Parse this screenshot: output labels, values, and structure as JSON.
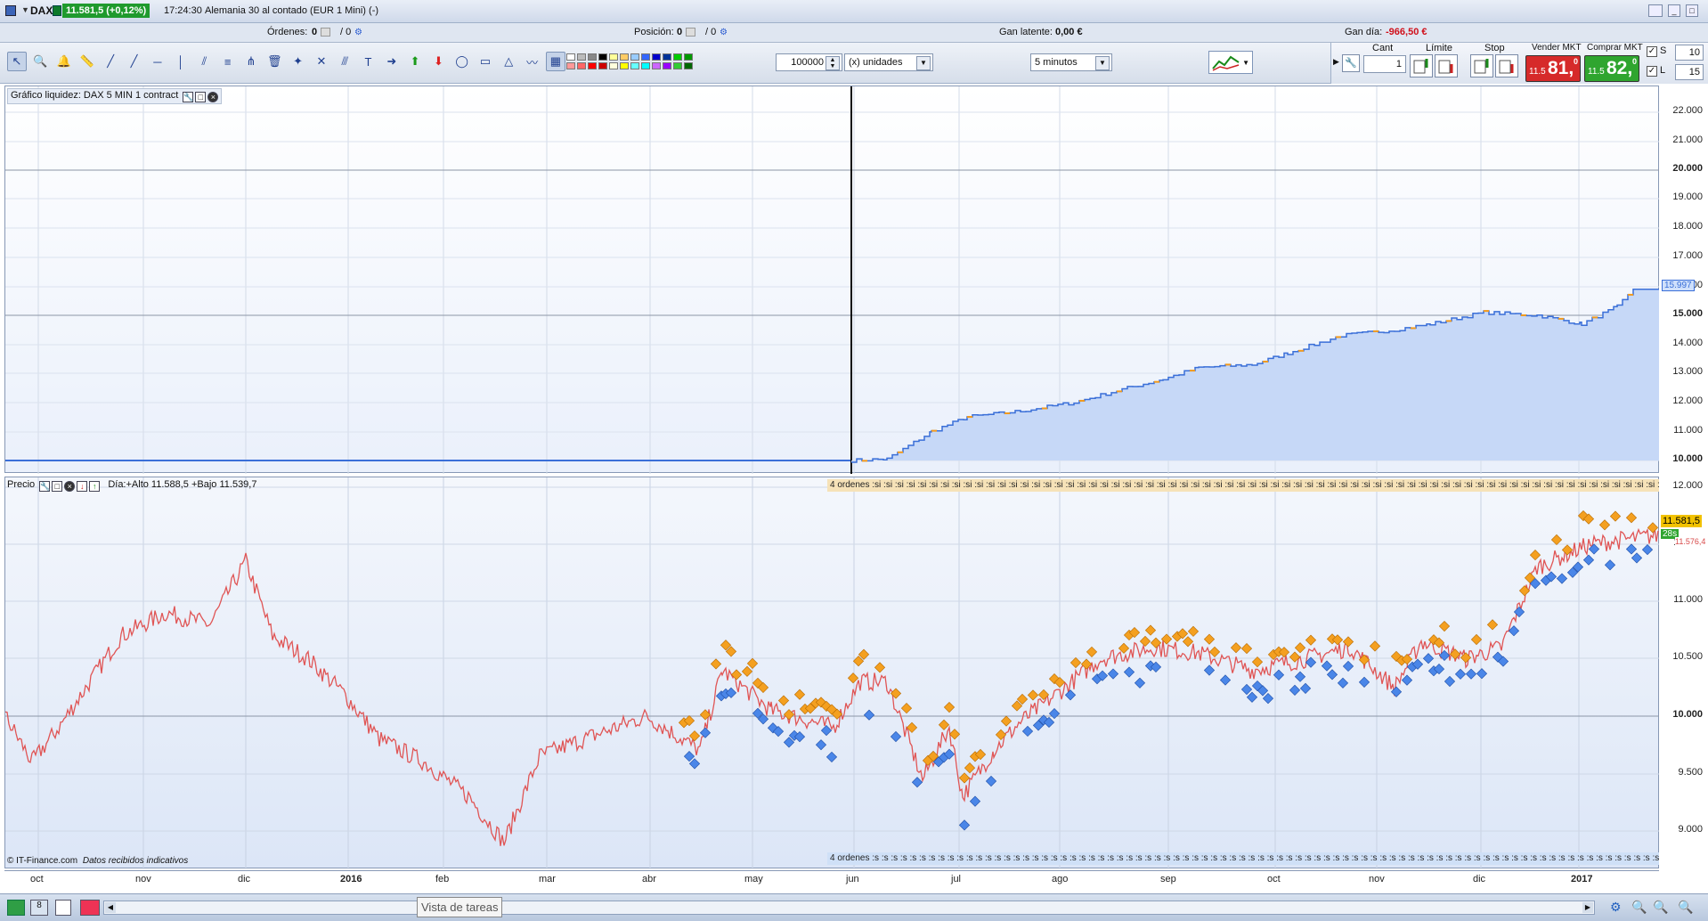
{
  "titlebar": {
    "symbol": "DAX",
    "price_badge": "11.581,5 (+0,12%)",
    "time": "17:24:30",
    "instrument": "Alemania 30 al contado (EUR 1 Mini) (-)"
  },
  "infobar": {
    "ordenes_label": "Órdenes:",
    "ordenes_value": "0",
    "ordenes_sep": "/ 0",
    "posicion_label": "Posición:",
    "posicion_value": "0",
    "posicion_sep": "/ 0",
    "gan_latente_label": "Gan latente:",
    "gan_latente_value": "0,00 €",
    "gan_dia_label": "Gan día:",
    "gan_dia_value": "-966,50 €",
    "gan_dia_color": "#d0101b"
  },
  "toolbar": {
    "quantity_value": "100000",
    "units_select": "(x) unidades",
    "timeframe_select": "5 minutos",
    "cant_label": "Cant",
    "cant_value": "1",
    "limite_label": "Límite",
    "stop_label": "Stop",
    "vender_label": "Vender MKT",
    "vender_small": "11.5",
    "vender_big": "81,",
    "vender_sup": "0",
    "comprar_label": "Comprar MKT",
    "comprar_small": "11.5",
    "comprar_big": "82,",
    "comprar_sup": "0",
    "s_label": "S",
    "s_value": "10",
    "l_label": "L",
    "l_value": "15",
    "sell_color": "#d62a2a",
    "buy_color": "#2fa52f",
    "icons": [
      "cursor-icon",
      "zoom-icon",
      "alarm-bell-icon",
      "ruler-icon",
      "line-tool-icon",
      "trendline-icon",
      "horizontal-line-icon",
      "vertical-line-icon",
      "channel-icon",
      "fibonacci-icon",
      "pitchfork-icon",
      "trash-icon",
      "magnet-icon",
      "cross-icon",
      "parallel-icon",
      "text-icon",
      "arrow-right-icon",
      "arrow-up-icon",
      "arrow-down-icon",
      "ellipse-icon",
      "rectangle-icon",
      "triangle-icon",
      "indicator-icon",
      "chart-style-icon"
    ]
  },
  "equity_panel": {
    "title": "Gráfico liquidez: DAX 5 MIN 1 contract",
    "last_value": "15.997",
    "yticks": [
      "22.000",
      "21.000",
      "20.000",
      "19.000",
      "18.000",
      "17.000",
      "16.000",
      "15.000",
      "14.000",
      "13.000",
      "12.000",
      "11.000",
      "10.000"
    ],
    "fill_color": "#c6d8f7",
    "line_color": "#3a6fd8",
    "segment_color": "#f29a1c"
  },
  "price_panel": {
    "title": "Precio",
    "day_info": "Día:+Alto 11.588,5 +Bajo 11.539,7",
    "orders_top": "4 ordenes",
    "orders_bottom": "4 ordenes",
    "last_price": "11.581,5",
    "countdown": "28s",
    "other_price": "11.576,4",
    "yticks": [
      "12.000",
      "11.500",
      "11.000",
      "10.500",
      "10.000",
      "9.500",
      "9.000"
    ],
    "line_color": "#e05555",
    "sell_marker_color": "#f4a020",
    "buy_marker_color": "#4a86e8",
    "source_text": "© IT-Finance.com",
    "source_note": "Datos recibidos indicativos"
  },
  "xaxis": {
    "labels": [
      "oct",
      "nov",
      "dic",
      "2016",
      "feb",
      "mar",
      "abr",
      "may",
      "jun",
      "jul",
      "ago",
      "sep",
      "oct",
      "nov",
      "dic",
      "2017"
    ]
  },
  "bottombar": {
    "taskbar_tooltip": "Vista de tareas"
  }
}
